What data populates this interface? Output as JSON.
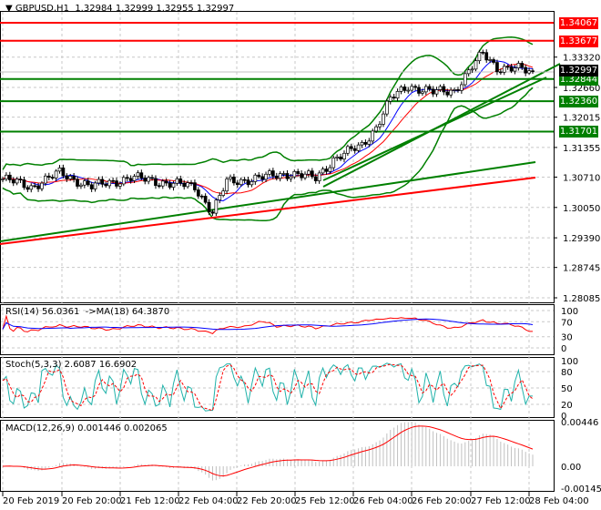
{
  "header": {
    "symbol": "GBPUSD,H1",
    "ohlc": "1.32984 1.32999 1.32955 1.32997"
  },
  "price_scale": [
    "1.33320",
    "1.32660",
    "1.32015",
    "1.31355",
    "1.30710",
    "1.30050",
    "1.29390",
    "1.28745",
    "1.28085"
  ],
  "levels": [
    {
      "price": "1.34067",
      "color": "#ff0000"
    },
    {
      "price": "1.33677",
      "color": "#ff0000"
    },
    {
      "price": "1.32844",
      "color": "#008000"
    },
    {
      "price": "1.32360",
      "color": "#008000"
    },
    {
      "price": "1.31701",
      "color": "#008000"
    }
  ],
  "current_price": "1.32997",
  "rsi": {
    "label": "RSI(14) 56.0361  ->MA(18) 64.3870",
    "scale": [
      "100",
      "70",
      "30",
      "0"
    ]
  },
  "stoch": {
    "label": "Stoch(5,3,3) 2.6087 16.6902",
    "scale": [
      "100",
      "80",
      "50",
      "20",
      "0"
    ]
  },
  "macd": {
    "label": "MACD(12,26,9) 0.001446 0.002065",
    "scale": [
      "0.00446",
      "0.00",
      "-0.001452"
    ]
  },
  "time_axis": [
    "20 Feb 2019",
    "20 Feb 20:00",
    "21 Feb 12:00",
    "22 Feb 04:00",
    "22 Feb 20:00",
    "25 Feb 12:00",
    "26 Feb 04:00",
    "26 Feb 20:00",
    "27 Feb 12:00",
    "28 Feb 04:00"
  ],
  "chart_data": {
    "type": "candlestick",
    "keypoint_closes": [
      [
        0,
        1.3067
      ],
      [
        8,
        1.305
      ],
      [
        16,
        1.308
      ],
      [
        25,
        1.305
      ],
      [
        36,
        1.307
      ],
      [
        45,
        1.306
      ],
      [
        54,
        1.305
      ],
      [
        59,
        1.2995
      ],
      [
        63,
        1.306
      ],
      [
        73,
        1.307
      ],
      [
        81,
        1.308
      ],
      [
        88,
        1.3068
      ],
      [
        93,
        1.311
      ],
      [
        101,
        1.314
      ],
      [
        105,
        1.318
      ],
      [
        109,
        1.324
      ],
      [
        114,
        1.327
      ],
      [
        121,
        1.3255
      ],
      [
        127,
        1.326
      ],
      [
        131,
        1.33
      ],
      [
        135,
        1.334
      ],
      [
        139,
        1.331
      ],
      [
        146,
        1.3305
      ],
      [
        149,
        1.3297
      ]
    ],
    "bars": 150,
    "ylim": [
      1.28085,
      1.34067
    ]
  }
}
